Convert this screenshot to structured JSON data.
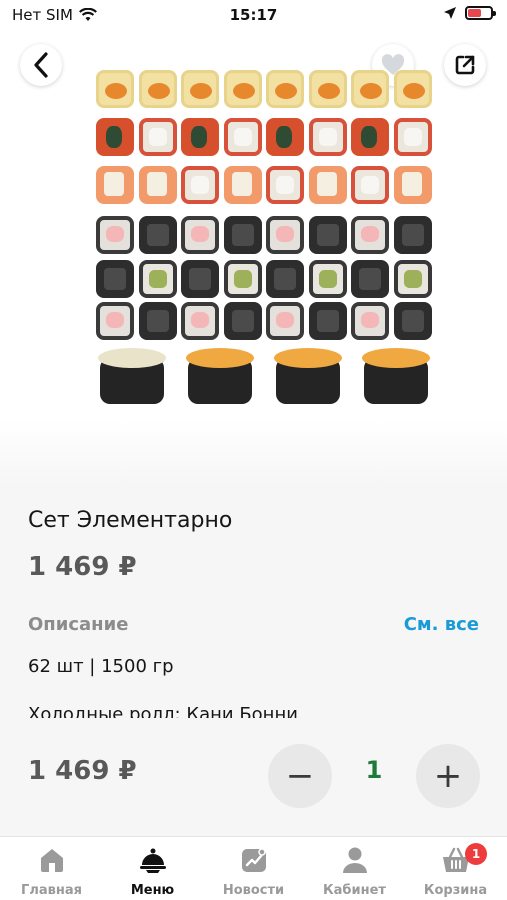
{
  "status_bar": {
    "carrier": "Нет SIM",
    "time": "15:17"
  },
  "product": {
    "title": "Сет Элементарно",
    "price": "1 469 ₽",
    "description_label": "Описание",
    "see_all_label": "См. все",
    "description_line1": "62 шт | 1500 гр",
    "description_line2": "Холодные ролл: Кани Бонни"
  },
  "order_bar": {
    "price": "1 469 ₽",
    "minus_symbol": "−",
    "plus_symbol": "+",
    "quantity": "1"
  },
  "tab_bar": {
    "tabs": [
      {
        "label": "Главная",
        "icon": "home-icon"
      },
      {
        "label": "Меню",
        "icon": "cloche-icon"
      },
      {
        "label": "Новости",
        "icon": "news-icon"
      },
      {
        "label": "Кабинет",
        "icon": "person-icon"
      },
      {
        "label": "Корзина",
        "icon": "basket-icon"
      }
    ],
    "active": "Меню",
    "cart_badge": "1"
  },
  "colors": {
    "accent_link": "#1a9bd7",
    "quantity_green": "#1e7a3a",
    "badge_red": "#ee3b3b",
    "price_grey": "#595959"
  }
}
